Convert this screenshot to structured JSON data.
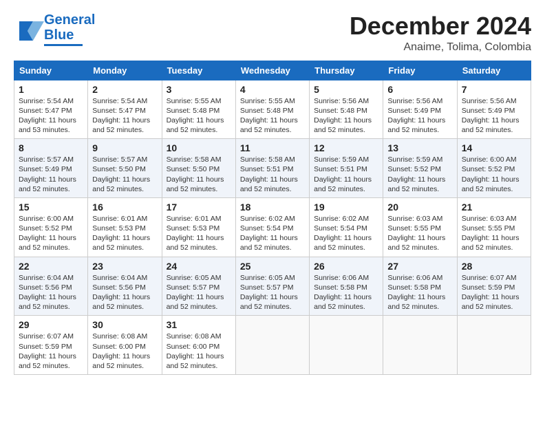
{
  "header": {
    "logo_line1": "General",
    "logo_line2": "Blue",
    "month": "December 2024",
    "location": "Anaime, Tolima, Colombia"
  },
  "weekdays": [
    "Sunday",
    "Monday",
    "Tuesday",
    "Wednesday",
    "Thursday",
    "Friday",
    "Saturday"
  ],
  "rows": [
    [
      {
        "day": "1",
        "info": "Sunrise: 5:54 AM\nSunset: 5:47 PM\nDaylight: 11 hours\nand 53 minutes."
      },
      {
        "day": "2",
        "info": "Sunrise: 5:54 AM\nSunset: 5:47 PM\nDaylight: 11 hours\nand 52 minutes."
      },
      {
        "day": "3",
        "info": "Sunrise: 5:55 AM\nSunset: 5:48 PM\nDaylight: 11 hours\nand 52 minutes."
      },
      {
        "day": "4",
        "info": "Sunrise: 5:55 AM\nSunset: 5:48 PM\nDaylight: 11 hours\nand 52 minutes."
      },
      {
        "day": "5",
        "info": "Sunrise: 5:56 AM\nSunset: 5:48 PM\nDaylight: 11 hours\nand 52 minutes."
      },
      {
        "day": "6",
        "info": "Sunrise: 5:56 AM\nSunset: 5:49 PM\nDaylight: 11 hours\nand 52 minutes."
      },
      {
        "day": "7",
        "info": "Sunrise: 5:56 AM\nSunset: 5:49 PM\nDaylight: 11 hours\nand 52 minutes."
      }
    ],
    [
      {
        "day": "8",
        "info": "Sunrise: 5:57 AM\nSunset: 5:49 PM\nDaylight: 11 hours\nand 52 minutes."
      },
      {
        "day": "9",
        "info": "Sunrise: 5:57 AM\nSunset: 5:50 PM\nDaylight: 11 hours\nand 52 minutes."
      },
      {
        "day": "10",
        "info": "Sunrise: 5:58 AM\nSunset: 5:50 PM\nDaylight: 11 hours\nand 52 minutes."
      },
      {
        "day": "11",
        "info": "Sunrise: 5:58 AM\nSunset: 5:51 PM\nDaylight: 11 hours\nand 52 minutes."
      },
      {
        "day": "12",
        "info": "Sunrise: 5:59 AM\nSunset: 5:51 PM\nDaylight: 11 hours\nand 52 minutes."
      },
      {
        "day": "13",
        "info": "Sunrise: 5:59 AM\nSunset: 5:52 PM\nDaylight: 11 hours\nand 52 minutes."
      },
      {
        "day": "14",
        "info": "Sunrise: 6:00 AM\nSunset: 5:52 PM\nDaylight: 11 hours\nand 52 minutes."
      }
    ],
    [
      {
        "day": "15",
        "info": "Sunrise: 6:00 AM\nSunset: 5:52 PM\nDaylight: 11 hours\nand 52 minutes."
      },
      {
        "day": "16",
        "info": "Sunrise: 6:01 AM\nSunset: 5:53 PM\nDaylight: 11 hours\nand 52 minutes."
      },
      {
        "day": "17",
        "info": "Sunrise: 6:01 AM\nSunset: 5:53 PM\nDaylight: 11 hours\nand 52 minutes."
      },
      {
        "day": "18",
        "info": "Sunrise: 6:02 AM\nSunset: 5:54 PM\nDaylight: 11 hours\nand 52 minutes."
      },
      {
        "day": "19",
        "info": "Sunrise: 6:02 AM\nSunset: 5:54 PM\nDaylight: 11 hours\nand 52 minutes."
      },
      {
        "day": "20",
        "info": "Sunrise: 6:03 AM\nSunset: 5:55 PM\nDaylight: 11 hours\nand 52 minutes."
      },
      {
        "day": "21",
        "info": "Sunrise: 6:03 AM\nSunset: 5:55 PM\nDaylight: 11 hours\nand 52 minutes."
      }
    ],
    [
      {
        "day": "22",
        "info": "Sunrise: 6:04 AM\nSunset: 5:56 PM\nDaylight: 11 hours\nand 52 minutes."
      },
      {
        "day": "23",
        "info": "Sunrise: 6:04 AM\nSunset: 5:56 PM\nDaylight: 11 hours\nand 52 minutes."
      },
      {
        "day": "24",
        "info": "Sunrise: 6:05 AM\nSunset: 5:57 PM\nDaylight: 11 hours\nand 52 minutes."
      },
      {
        "day": "25",
        "info": "Sunrise: 6:05 AM\nSunset: 5:57 PM\nDaylight: 11 hours\nand 52 minutes."
      },
      {
        "day": "26",
        "info": "Sunrise: 6:06 AM\nSunset: 5:58 PM\nDaylight: 11 hours\nand 52 minutes."
      },
      {
        "day": "27",
        "info": "Sunrise: 6:06 AM\nSunset: 5:58 PM\nDaylight: 11 hours\nand 52 minutes."
      },
      {
        "day": "28",
        "info": "Sunrise: 6:07 AM\nSunset: 5:59 PM\nDaylight: 11 hours\nand 52 minutes."
      }
    ],
    [
      {
        "day": "29",
        "info": "Sunrise: 6:07 AM\nSunset: 5:59 PM\nDaylight: 11 hours\nand 52 minutes."
      },
      {
        "day": "30",
        "info": "Sunrise: 6:08 AM\nSunset: 6:00 PM\nDaylight: 11 hours\nand 52 minutes."
      },
      {
        "day": "31",
        "info": "Sunrise: 6:08 AM\nSunset: 6:00 PM\nDaylight: 11 hours\nand 52 minutes."
      },
      {
        "day": "",
        "info": ""
      },
      {
        "day": "",
        "info": ""
      },
      {
        "day": "",
        "info": ""
      },
      {
        "day": "",
        "info": ""
      }
    ]
  ]
}
